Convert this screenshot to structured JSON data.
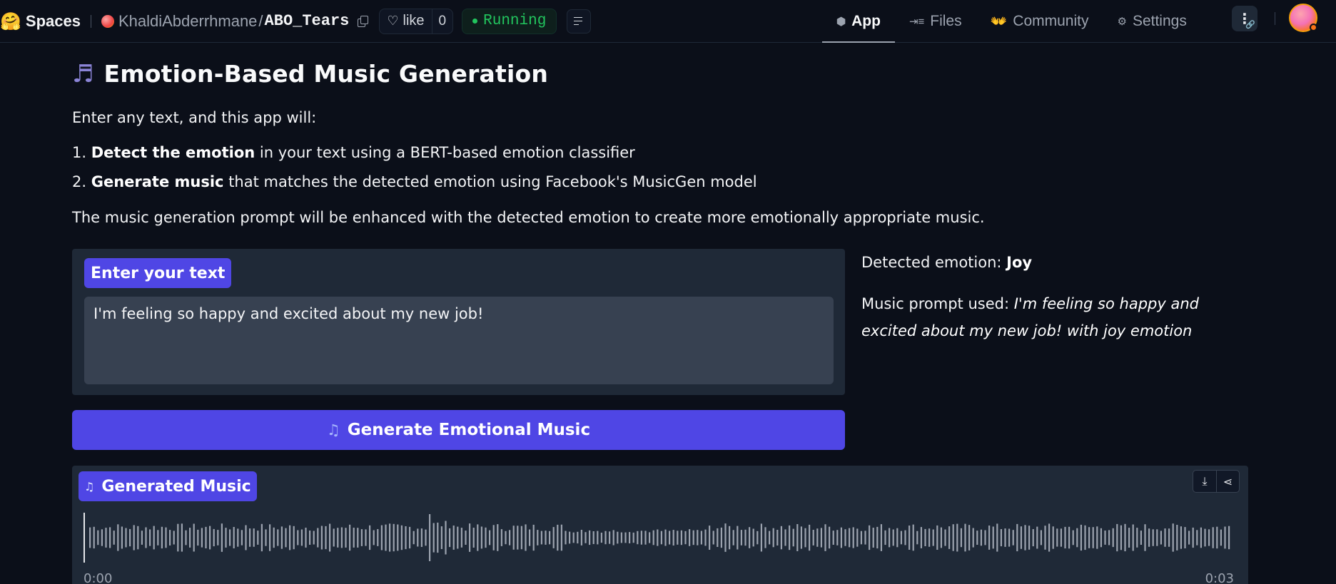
{
  "nav": {
    "brand": "Spaces",
    "owner": "KhaldiAbderrhmane",
    "separator": "/",
    "repo": "ABO_Tears",
    "like_label": "like",
    "like_count": "0",
    "status": "Running",
    "tabs": [
      {
        "label": "App",
        "icon": "cube-icon"
      },
      {
        "label": "Files",
        "icon": "files-icon"
      },
      {
        "label": "Community",
        "icon": "community-icon"
      },
      {
        "label": "Settings",
        "icon": "gear-icon"
      }
    ],
    "colors": {
      "status": "#22c55e",
      "background": "#0b0f19"
    }
  },
  "main": {
    "title": "Emotion-Based Music Generation",
    "intro": "Enter any text, and this app will:",
    "steps": [
      {
        "number": "1.",
        "bold": "Detect the emotion",
        "rest": " in your text using a BERT-based emotion classifier"
      },
      {
        "number": "2.",
        "bold": "Generate music",
        "rest": " that matches the detected emotion using Facebook's MusicGen model"
      }
    ],
    "description": "The music generation prompt will be enhanced with the detected emotion to create more emotionally appropriate music.",
    "input_label": "Enter your text",
    "input_value": "I'm feeling so happy and excited about my new job!",
    "generate_button": "Generate Emotional Music",
    "emotion_label": "Detected emotion: ",
    "emotion_value": "Joy",
    "prompt_label": "Music prompt used: ",
    "prompt_value": "I'm feeling so happy and excited about my new job! with joy emotion",
    "audio_label": "Generated Music",
    "audio_time_start": "0:00",
    "audio_time_end": "0:03",
    "colors": {
      "accent": "#4f46e5",
      "panel": "#1f2937",
      "input": "#374151"
    }
  }
}
